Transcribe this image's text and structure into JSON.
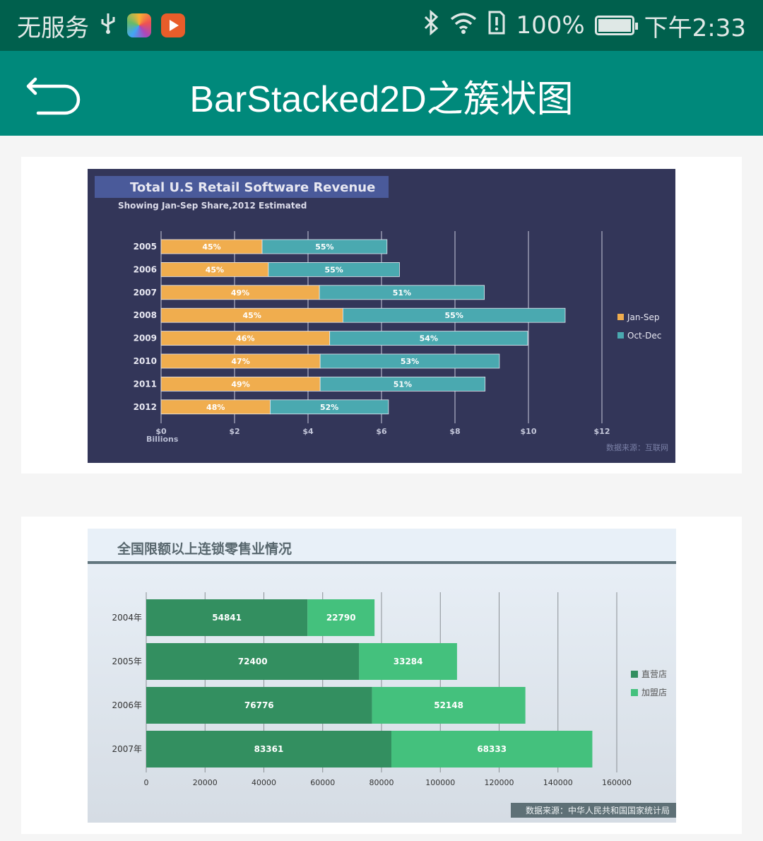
{
  "status_bar": {
    "carrier": "无服务",
    "battery_percent": "100%",
    "time": "下午2:33",
    "icons": [
      "usb-icon",
      "photos-app-icon",
      "video-app-icon",
      "bluetooth-icon",
      "wifi-icon",
      "sim-alert-icon",
      "battery-charging-icon"
    ]
  },
  "toolbar": {
    "title": "BarStacked2D之簇状图",
    "back_icon": "back-arrow-icon"
  },
  "colors": {
    "toolbar": "#00897b",
    "status_bar": "#00604d",
    "chart1_bg": "#333659",
    "chart1_title_bg": "#4a5a9a",
    "jan_sep": "#f0ad4e",
    "oct_dec": "#4aa9b0",
    "direct": "#338f60",
    "franchise": "#44c17d"
  },
  "chart_data": [
    {
      "type": "bar",
      "orientation": "horizontal",
      "stacked": true,
      "title": "Total U.S Retail Software Revenue",
      "subtitle": "Showing Jan-Sep Share,2012 Estimated",
      "categories": [
        "2005",
        "2006",
        "2007",
        "2008",
        "2009",
        "2010",
        "2011",
        "2012"
      ],
      "series": [
        {
          "name": "Jan-Sep",
          "values": [
            2.75,
            2.92,
            4.31,
            4.95,
            4.59,
            4.33,
            4.33,
            2.97
          ],
          "labels": [
            "45%",
            "45%",
            "49%",
            "45%",
            "46%",
            "47%",
            "49%",
            "48%"
          ]
        },
        {
          "name": "Oct-Dec",
          "values": [
            3.4,
            3.57,
            4.49,
            6.05,
            5.39,
            4.88,
            4.49,
            3.22
          ],
          "labels": [
            "55%",
            "55%",
            "51%",
            "55%",
            "54%",
            "53%",
            "51%",
            "52%"
          ]
        }
      ],
      "xticks": [
        "$0",
        "$2",
        "$4",
        "$6",
        "$8",
        "$10",
        "$12"
      ],
      "xlim": [
        0,
        12
      ],
      "xunit_label": "Billions",
      "legend_position": "right",
      "source_note": "数据来源：互联网"
    },
    {
      "type": "bar",
      "orientation": "horizontal",
      "stacked": true,
      "title": "全国限额以上连锁零售业情况",
      "categories": [
        "2004年",
        "2005年",
        "2006年",
        "2007年"
      ],
      "series": [
        {
          "name": "直营店",
          "values": [
            54841,
            72400,
            76776,
            83361
          ]
        },
        {
          "name": "加盟店",
          "values": [
            22790,
            33284,
            52148,
            68333
          ]
        }
      ],
      "xticks": [
        "0",
        "20000",
        "40000",
        "60000",
        "80000",
        "100000",
        "120000",
        "140000",
        "160000"
      ],
      "xlim": [
        0,
        160000
      ],
      "legend_position": "right",
      "source_note": "数据来源：中华人民共和国国家统计局"
    }
  ]
}
